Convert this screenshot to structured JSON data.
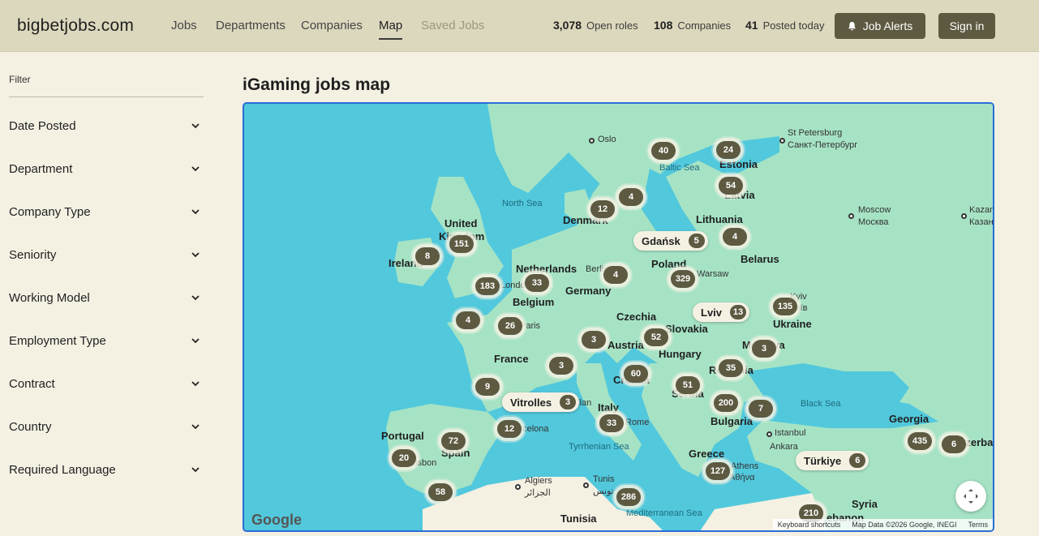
{
  "site": {
    "logo": "bigbetjobs.com"
  },
  "nav": [
    {
      "label": "Jobs"
    },
    {
      "label": "Departments"
    },
    {
      "label": "Companies"
    },
    {
      "label": "Map"
    },
    {
      "label": "Saved Jobs"
    }
  ],
  "stats": [
    {
      "value": "3,078",
      "label": "Open roles"
    },
    {
      "value": "108",
      "label": "Companies"
    },
    {
      "value": "41",
      "label": "Posted today"
    }
  ],
  "buttons": {
    "alerts": "Job Alerts",
    "signin": "Sign in"
  },
  "sidebar": {
    "filter_label": "Filter",
    "facets": [
      {
        "label": "Date Posted"
      },
      {
        "label": "Department"
      },
      {
        "label": "Company Type"
      },
      {
        "label": "Seniority"
      },
      {
        "label": "Working Model"
      },
      {
        "label": "Employment Type"
      },
      {
        "label": "Contract"
      },
      {
        "label": "Country"
      },
      {
        "label": "Required Language"
      }
    ]
  },
  "main": {
    "title": "iGaming jobs map"
  },
  "map": {
    "labels": {
      "oslo": "Oslo",
      "st_petersburg": "St Petersburg",
      "st_petersburg_ru": "Санкт-Петербург",
      "baltic_sea": "Baltic Sea",
      "estonia": "Estonia",
      "latvia": "Latvia",
      "north_sea": "North Sea",
      "united_kingdom_1": "United",
      "united_kingdom_2": "Kingdom",
      "denmark": "Denmark",
      "lithuania": "Lithuania",
      "moscow": "Moscow",
      "moscow_ru": "Москва",
      "kazan": "Kazan",
      "kazan_ru": "Казань",
      "ireland": "Ireland",
      "netherlands": "Netherlands",
      "berlin": "Berlin",
      "poland": "Poland",
      "belarus": "Belarus",
      "warsaw": "Warsaw",
      "london": "London",
      "germany": "Germany",
      "belgium": "Belgium",
      "kyiv": "Kyiv",
      "kyiv_ru": "Київ",
      "czechia": "Czechia",
      "slovakia": "Slovakia",
      "ukraine": "Ukraine",
      "paris": "Paris",
      "austria": "Austria",
      "moldova": "Moldova",
      "hungary": "Hungary",
      "france": "France",
      "croatia": "Croatia",
      "romania": "Romania",
      "serbia": "Serbia",
      "milan": "Milan",
      "black_sea": "Black Sea",
      "italy": "Italy",
      "rome": "Rome",
      "bulgaria": "Bulgaria",
      "georgia": "Georgia",
      "portugal": "Portugal",
      "barcelona": "Barcelona",
      "istanbul": "Istanbul",
      "spain": "Spain",
      "azerbaijan": "Azerbaijan",
      "lisbon": "Lisbon",
      "tyrrhenian_sea": "Tyrrhenian Sea",
      "greece": "Greece",
      "ankara": "Ankara",
      "athens": "Athens",
      "athens_gr": "Αθήνα",
      "algiers": "Algiers",
      "algiers_ar": "الجزائر",
      "tunis": "Tunis",
      "tunis_ar": "تونس",
      "syria": "Syria",
      "tunisia": "Tunisia",
      "mediterranean_sea": "Mediterranean Sea",
      "lebanon": "Lebanon"
    },
    "clusters": [
      "40",
      "24",
      "4",
      "54",
      "12",
      "151",
      "4",
      "8",
      "33",
      "4",
      "329",
      "183",
      "135",
      "4",
      "26",
      "3",
      "52",
      "3",
      "35",
      "3",
      "60",
      "9",
      "51",
      "200",
      "7",
      "33",
      "12",
      "72",
      "435",
      "6",
      "20",
      "127",
      "58",
      "286",
      "210"
    ],
    "pills": [
      {
        "name": "Gdańsk",
        "count": "5"
      },
      {
        "name": "Lviv",
        "count": "13"
      },
      {
        "name": "Vitrolles",
        "count": "3"
      },
      {
        "name": "Türkiye",
        "count": "6"
      }
    ],
    "google_logo": "Google",
    "attribution": {
      "shortcuts": "Keyboard shortcuts",
      "data": "Map Data ©2026 Google, INEGI",
      "terms": "Terms"
    }
  },
  "colors": {
    "brand": "#5d5a41",
    "header_bg": "#dcd8bd",
    "page_bg": "#f4f1e3",
    "sea": "#52c8dc",
    "land": "#a6e3c5"
  }
}
